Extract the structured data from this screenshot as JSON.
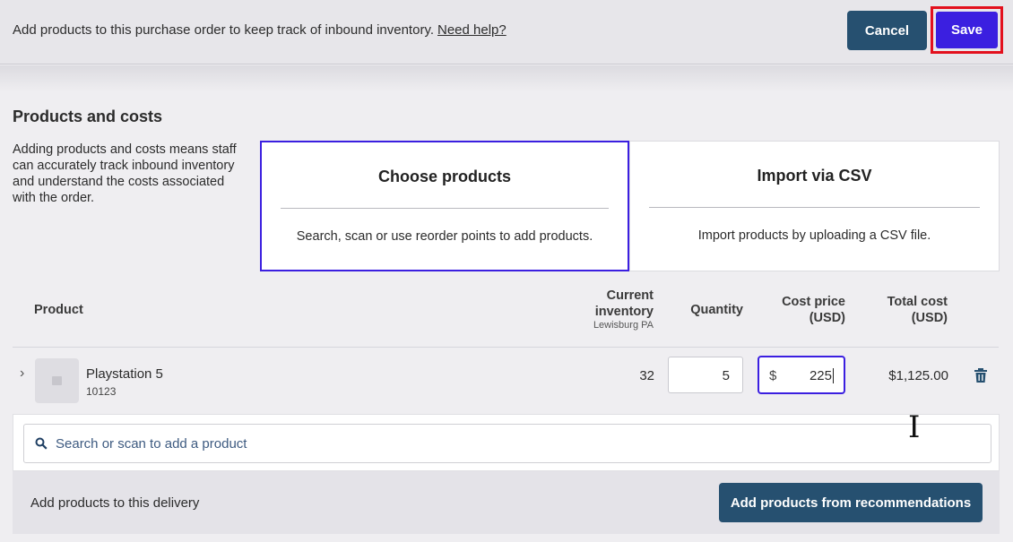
{
  "header": {
    "message": "Add products to this purchase order to keep track of inbound inventory.",
    "help_link": "Need help?",
    "cancel_label": "Cancel",
    "save_label": "Save"
  },
  "section": {
    "title": "Products and costs",
    "description": "Adding products and costs means staff can accurately track inbound inventory and understand the costs associated with the order."
  },
  "options": [
    {
      "title": "Choose products",
      "subtitle": "Search, scan or use reorder points to add products.",
      "selected": true
    },
    {
      "title": "Import via CSV",
      "subtitle": "Import products by uploading a CSV file.",
      "selected": false
    }
  ],
  "table": {
    "headers": {
      "product": "Product",
      "inventory": "Current inventory",
      "inventory_sub": "Lewisburg PA",
      "quantity": "Quantity",
      "cost_line1": "Cost price",
      "cost_line2": "(USD)",
      "total_line1": "Total cost",
      "total_line2": "(USD)"
    },
    "rows": [
      {
        "name": "Playstation 5",
        "sku": "10123",
        "inventory": "32",
        "quantity": "5",
        "currency": "$",
        "cost": "225",
        "total": "$1,125.00"
      }
    ]
  },
  "search": {
    "placeholder": "Search or scan to add a product"
  },
  "footer": {
    "message": "Add products to this delivery",
    "button_label": "Add products from recommendations"
  },
  "colors": {
    "primary": "#265070",
    "accent": "#3b1fe0",
    "highlight": "#e3101d"
  },
  "icons": [
    "search-icon",
    "trash-icon",
    "chevron-right-icon",
    "text-cursor-icon",
    "product-placeholder-icon"
  ]
}
